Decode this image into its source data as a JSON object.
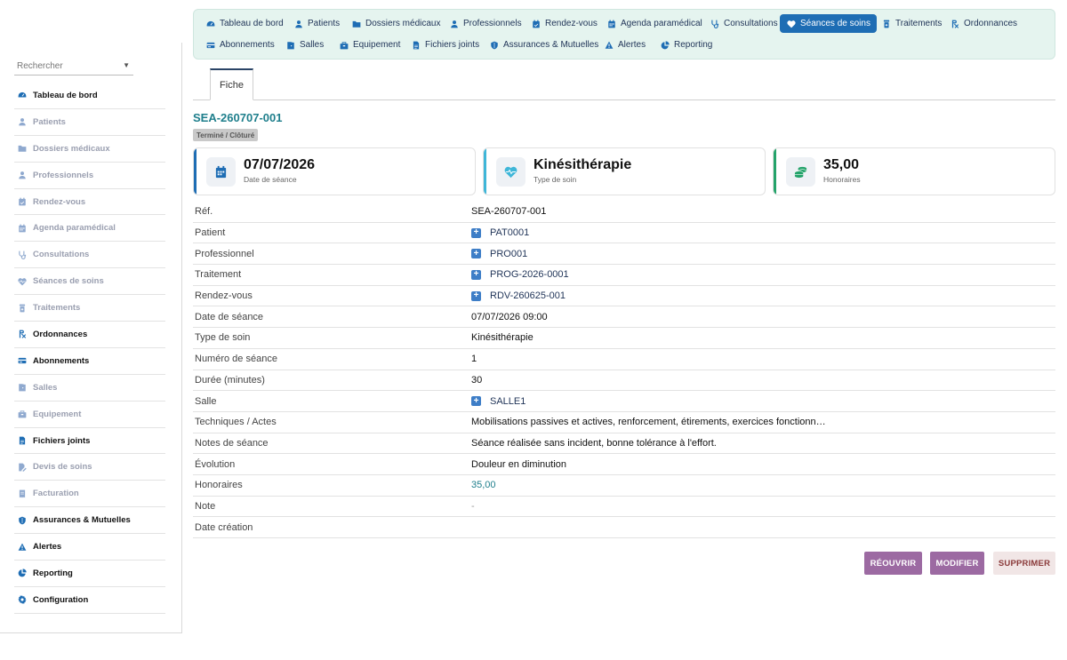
{
  "sidebar": {
    "search_placeholder": "Rechercher",
    "items": [
      {
        "label": "Tableau de bord",
        "icon": "gauge-icon",
        "active": true
      },
      {
        "label": "Patients",
        "icon": "user-icon",
        "active": false
      },
      {
        "label": "Dossiers médicaux",
        "icon": "folder-icon",
        "active": false
      },
      {
        "label": "Professionnels",
        "icon": "user-icon",
        "active": false
      },
      {
        "label": "Rendez-vous",
        "icon": "calendar-check-icon",
        "active": false
      },
      {
        "label": "Agenda paramédical",
        "icon": "calendar-icon",
        "active": false
      },
      {
        "label": "Consultations",
        "icon": "stethoscope-icon",
        "active": false
      },
      {
        "label": "Séances de soins",
        "icon": "heart-pulse-icon",
        "active": false
      },
      {
        "label": "Traitements",
        "icon": "pill-bottle-icon",
        "active": false
      },
      {
        "label": "Ordonnances",
        "icon": "prescription-icon",
        "active": true
      },
      {
        "label": "Abonnements",
        "icon": "card-icon",
        "active": true
      },
      {
        "label": "Salles",
        "icon": "door-icon",
        "active": false
      },
      {
        "label": "Equipement",
        "icon": "toolbox-icon",
        "active": false
      },
      {
        "label": "Fichiers joints",
        "icon": "file-icon",
        "active": true
      },
      {
        "label": "Devis de soins",
        "icon": "file-edit-icon",
        "active": false
      },
      {
        "label": "Facturation",
        "icon": "invoice-icon",
        "active": false
      },
      {
        "label": "Assurances & Mutuelles",
        "icon": "shield-icon",
        "active": true
      },
      {
        "label": "Alertes",
        "icon": "warning-icon",
        "active": true
      },
      {
        "label": "Reporting",
        "icon": "pie-chart-icon",
        "active": true
      },
      {
        "label": "Configuration",
        "icon": "gear-icon",
        "active": true
      }
    ]
  },
  "topnav": {
    "items": [
      {
        "label": "Tableau de bord",
        "icon": "gauge-icon",
        "active": false
      },
      {
        "label": "Patients",
        "icon": "user-icon",
        "active": false
      },
      {
        "label": "Dossiers médicaux",
        "icon": "folder-icon",
        "active": false
      },
      {
        "label": "Professionnels",
        "icon": "user-icon",
        "active": false
      },
      {
        "label": "Rendez-vous",
        "icon": "calendar-check-icon",
        "active": false
      },
      {
        "label": "Agenda paramédical",
        "icon": "calendar-icon",
        "active": false
      },
      {
        "label": "Consultations",
        "icon": "stethoscope-icon",
        "active": false
      },
      {
        "label": "Séances de soins",
        "icon": "heart-pulse-icon",
        "active": true
      },
      {
        "label": "Traitements",
        "icon": "pill-bottle-icon",
        "active": false
      },
      {
        "label": "Ordonnances",
        "icon": "prescription-icon",
        "active": false
      },
      {
        "label": "Abonnements",
        "icon": "card-icon",
        "active": false
      },
      {
        "label": "Salles",
        "icon": "door-icon",
        "active": false
      },
      {
        "label": "Equipement",
        "icon": "toolbox-icon",
        "active": false
      },
      {
        "label": "Fichiers joints",
        "icon": "file-icon",
        "active": false
      },
      {
        "label": "Assurances & Mutuelles",
        "icon": "shield-icon",
        "active": false
      },
      {
        "label": "Alertes",
        "icon": "warning-icon",
        "active": false
      },
      {
        "label": "Reporting",
        "icon": "pie-chart-icon",
        "active": false
      }
    ]
  },
  "tabs": {
    "fiche": "Fiche"
  },
  "record": {
    "ref": "SEA-260707-001",
    "status": "Terminé / Clôturé"
  },
  "cards": [
    {
      "value": "07/07/2026",
      "label": "Date de séance",
      "icon": "calendar-icon",
      "accent": "#1e6db4"
    },
    {
      "value": "Kinésithérapie",
      "label": "Type de soin",
      "icon": "heart-pulse-icon",
      "accent": "#3fb6d8"
    },
    {
      "value": "35,00",
      "label": "Honoraires",
      "icon": "coins-icon",
      "accent": "#24a36a"
    }
  ],
  "fields": [
    {
      "label": "Réf.",
      "value": "SEA-260707-001",
      "type": "text"
    },
    {
      "label": "Patient",
      "value": "PAT0001",
      "type": "link"
    },
    {
      "label": "Professionnel",
      "value": "PRO001",
      "type": "link"
    },
    {
      "label": "Traitement",
      "value": "PROG-2026-0001",
      "type": "link"
    },
    {
      "label": "Rendez-vous",
      "value": "RDV-260625-001",
      "type": "link"
    },
    {
      "label": "Date de séance",
      "value": "07/07/2026 09:00",
      "type": "text"
    },
    {
      "label": "Type de soin",
      "value": "Kinésithérapie",
      "type": "text"
    },
    {
      "label": "Numéro de séance",
      "value": "1",
      "type": "text"
    },
    {
      "label": "Durée (minutes)",
      "value": "30",
      "type": "text"
    },
    {
      "label": "Salle",
      "value": "SALLE1",
      "type": "link"
    },
    {
      "label": "Techniques / Actes",
      "value": "Mobilisations passives et actives, renforcement, étirements, exercices fonctionn…",
      "type": "text"
    },
    {
      "label": "Notes de séance",
      "value": "Séance réalisée sans incident, bonne tolérance à l'effort.",
      "type": "text"
    },
    {
      "label": "Évolution",
      "value": "Douleur en diminution",
      "type": "text"
    },
    {
      "label": "Honoraires",
      "value": "35,00",
      "type": "teal"
    },
    {
      "label": "Note",
      "value": "-",
      "type": "muted"
    },
    {
      "label": "Date création",
      "value": "",
      "type": "text"
    }
  ],
  "actions": {
    "reopen": "RÉOUVRIR",
    "edit": "MODIFIER",
    "delete": "SUPPRIMER"
  },
  "colors": {
    "primary": "#1e6db4",
    "teal": "#1f7f8c",
    "action_purple": "#9c6aa2",
    "nav_bg": "#e5f4ef"
  }
}
